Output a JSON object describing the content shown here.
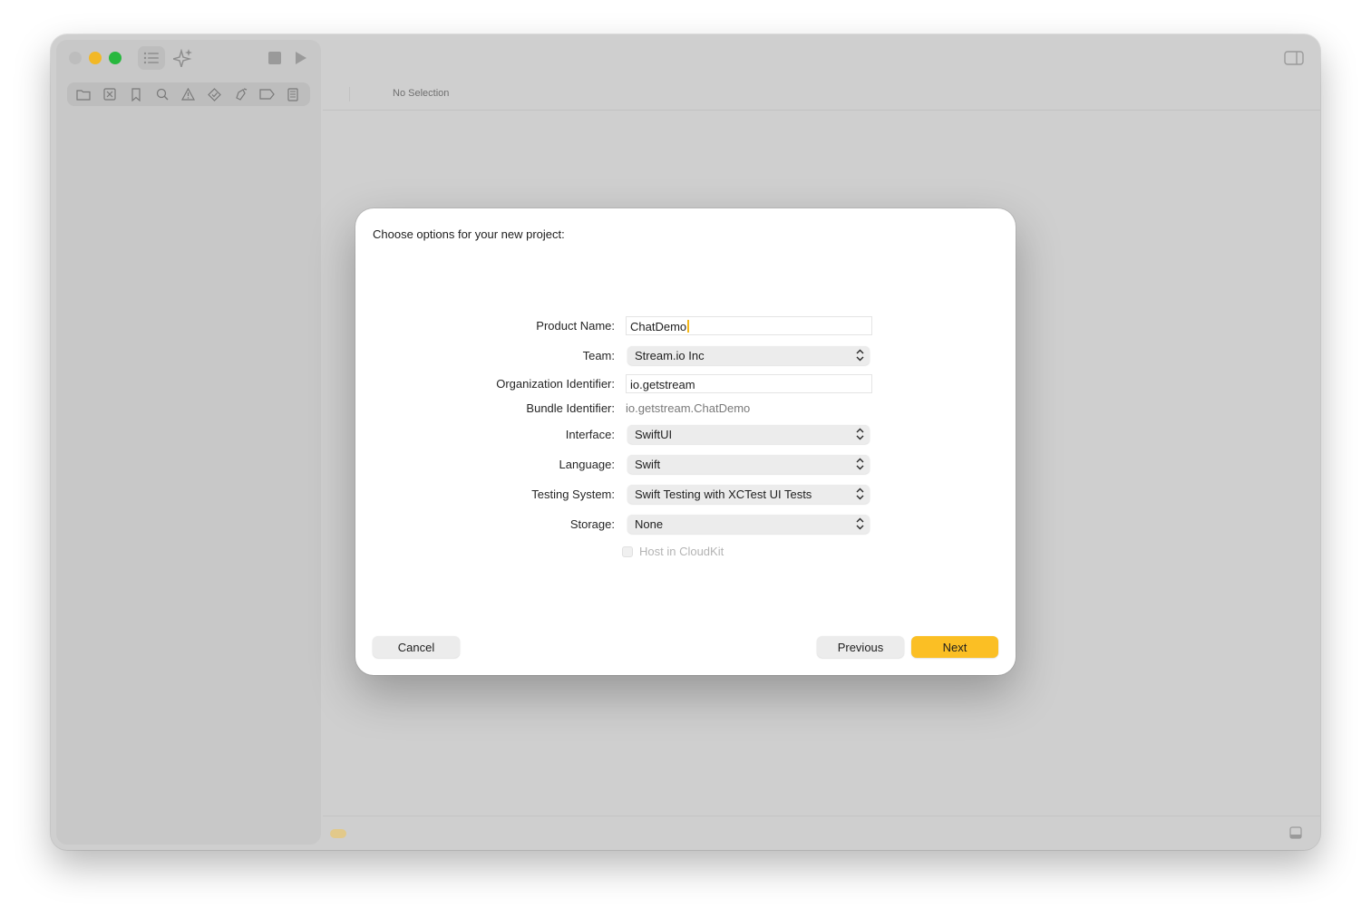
{
  "editor": {
    "no_selection_text": "No Selection"
  },
  "toolbar": {
    "icons": [
      "sidebar-toggle-icon",
      "sparkle-icon",
      "stop-icon",
      "play-icon",
      "inspector-toggle-icon"
    ]
  },
  "navigator": {
    "icons": [
      "folder-icon",
      "source-control-icon",
      "bookmark-icon",
      "search-icon",
      "warning-icon",
      "test-icon",
      "debug-icon",
      "breakpoint-icon",
      "report-icon"
    ]
  },
  "dialog": {
    "title": "Choose options for your new project:",
    "fields": {
      "product_name": {
        "label": "Product Name:",
        "value": "ChatDemo"
      },
      "team": {
        "label": "Team:",
        "value": "Stream.io Inc"
      },
      "organization_identifier": {
        "label": "Organization Identifier:",
        "value": "io.getstream"
      },
      "bundle_identifier": {
        "label": "Bundle Identifier:",
        "value": "io.getstream.ChatDemo"
      },
      "interface": {
        "label": "Interface:",
        "value": "SwiftUI"
      },
      "language": {
        "label": "Language:",
        "value": "Swift"
      },
      "testing_system": {
        "label": "Testing System:",
        "value": "Swift Testing with XCTest UI Tests"
      },
      "storage": {
        "label": "Storage:",
        "value": "None"
      }
    },
    "host_in_cloudkit": {
      "label": "Host in CloudKit",
      "checked": false,
      "enabled": false
    },
    "buttons": {
      "cancel": "Cancel",
      "previous": "Previous",
      "next": "Next"
    }
  },
  "colors": {
    "accent": "#fbbf24",
    "window_bg": "#cfcfcf",
    "dialog_bg": "#ffffff"
  }
}
